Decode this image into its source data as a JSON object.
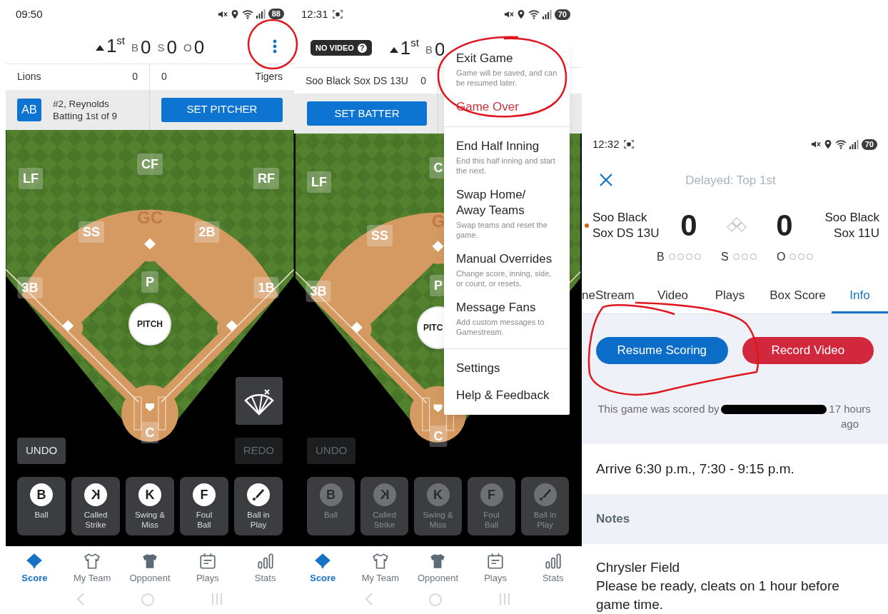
{
  "scorer_screen": {
    "annotated": true,
    "status_bar": {
      "time": "09:50",
      "recording_icon": false,
      "battery": "88"
    },
    "header": {
      "inning": "1$^{st}$",
      "count": [
        {
          "label": "B",
          "value": "0"
        },
        {
          "label": "S",
          "value": "0"
        },
        {
          "label": "O",
          "value": "0"
        }
      ],
      "menu_button": true
    },
    "teams": [
      {
        "name": "Lions",
        "score": "0"
      },
      {
        "name": "Tigers",
        "score": "0"
      }
    ],
    "batter": {
      "badge": "AB",
      "name": "#2, Reynolds",
      "order": "Batting 1st of 9"
    },
    "action": "SET PITCHER",
    "field": {
      "logo": "GC",
      "pitch": "PITCH",
      "spray_chart_button": true,
      "positions": {
        "left_field": "LF",
        "center_field": "CF",
        "right_field": "RF",
        "shortstop": "SS",
        "second_base": "2B",
        "third_base": "3B",
        "first_base": "1B",
        "pitcher": "P",
        "catcher": "C"
      }
    },
    "undo": {
      "label": "UNDO",
      "disabled": false
    },
    "redo": {
      "label": "REDO",
      "disabled": true
    },
    "pitches_disabled": false,
    "pitches": [
      {
        "kind": "letter",
        "symbol": "B",
        "mirrored": false,
        "label": "Ball"
      },
      {
        "kind": "letter",
        "symbol": "K",
        "mirrored": true,
        "label": "Called\nStrike"
      },
      {
        "kind": "letter",
        "symbol": "K",
        "mirrored": false,
        "label": "Swing &\nMiss"
      },
      {
        "kind": "letter",
        "symbol": "F",
        "mirrored": false,
        "label": "Foul\nBall"
      },
      {
        "kind": "icon",
        "label": "Ball in\nPlay"
      }
    ],
    "nav": [
      {
        "label": "Score",
        "selected": true
      },
      {
        "label": "My Team",
        "selected": false
      },
      {
        "label": "Opponent",
        "selected": false
      },
      {
        "label": "Plays",
        "selected": false
      },
      {
        "label": "Stats",
        "selected": false
      }
    ]
  },
  "menu_screen": {
    "annotated": true,
    "status_bar": {
      "time": "12:31",
      "recording_icon": true,
      "battery": "70"
    },
    "header": {
      "video_badge": "NO VIDEO",
      "video_help": "?",
      "inning": "1$^{st}$",
      "count": [
        {
          "label": "B",
          "value": "0"
        }
      ],
      "menu_button": false
    },
    "teams": [
      {
        "name": "Soo Black Sox DS 13U",
        "score": "0"
      }
    ],
    "action": "SET BATTER",
    "field": {
      "logo": "G",
      "pitch": "PITC",
      "spray_chart_button": false,
      "positions": {
        "left_field": "LF",
        "center_field": "C",
        "shortstop": "SS",
        "third_base": "3B",
        "pitcher": "P",
        "catcher": "C"
      }
    },
    "undo": {
      "label": "UNDO",
      "disabled": true
    },
    "pitches_disabled": true,
    "pitches": [
      {
        "kind": "letter",
        "symbol": "B",
        "mirrored": false,
        "label": "Ball"
      },
      {
        "kind": "letter",
        "symbol": "K",
        "mirrored": true,
        "label": "Called\nStrike"
      },
      {
        "kind": "letter",
        "symbol": "K",
        "mirrored": false,
        "label": "Swing &\nMiss"
      },
      {
        "kind": "letter",
        "symbol": "F",
        "mirrored": false,
        "label": "Foul\nBall"
      },
      {
        "kind": "icon",
        "label": "Ball in\nPlay"
      }
    ],
    "nav": [
      {
        "label": "Score",
        "selected": true
      },
      {
        "label": "My Team",
        "selected": false
      },
      {
        "label": "Opponent",
        "selected": false
      },
      {
        "label": "Plays",
        "selected": false
      },
      {
        "label": "Stats",
        "selected": false
      }
    ],
    "menu": [
      [
        {
          "title": "Exit Game",
          "description": "Game will be saved, and can be resumed later.",
          "kind": "normal"
        },
        {
          "title": "Game Over",
          "kind": "danger"
        }
      ],
      [
        {
          "title": "End Half Inning",
          "description": "End this half inning and start the next.",
          "kind": "normal"
        },
        {
          "title": "Swap Home/ Away Teams",
          "description": "Swap teams and reset the game.",
          "kind": "normal"
        },
        {
          "title": "Manual Overrides",
          "description": "Change score, inning, side, or count, or resets.",
          "kind": "normal"
        },
        {
          "title": "Message Fans",
          "description": "Add custom messages to Gamestream.",
          "kind": "normal"
        }
      ],
      [
        {
          "title": "Settings",
          "kind": "normal"
        },
        {
          "title": "Help & Feedback",
          "kind": "normal"
        }
      ]
    ]
  },
  "game_screen": {
    "annotated": true,
    "status_bar": {
      "time": "12:32",
      "recording_icon": true,
      "battery": "70"
    },
    "title": "Delayed: Top 1st",
    "teams": [
      {
        "name": "Soo Black Sox DS 13U",
        "score": "0",
        "batting": true
      },
      {
        "name": "Soo Black Sox 11U",
        "score": "0",
        "batting": false
      }
    ],
    "count": [
      {
        "label": "B",
        "lights": [
          false,
          false,
          false,
          false
        ]
      },
      {
        "label": "S",
        "lights": [
          false,
          false,
          false
        ]
      },
      {
        "label": "O",
        "lights": [
          false,
          false,
          false
        ]
      }
    ],
    "tabs": [
      {
        "label": "neStream",
        "selected": false
      },
      {
        "label": "Video",
        "selected": false
      },
      {
        "label": "Plays",
        "selected": false
      },
      {
        "label": "Box Score",
        "selected": false
      },
      {
        "label": "Info",
        "selected": true
      }
    ],
    "actions": [
      {
        "label": "Resume Scoring",
        "kind": "primary"
      },
      {
        "label": "Record Video",
        "kind": "danger"
      }
    ],
    "scored_by": {
      "before": "This game was scored by",
      "redacted": true,
      "after": "17 hours ago"
    },
    "schedule": "Arrive 6:30 p.m., 7:30 - 9:15 p.m.",
    "notes_heading": "Notes",
    "notes": [
      "Chrysler Field",
      "Please be ready, cleats on 1 hour before game time."
    ]
  }
}
